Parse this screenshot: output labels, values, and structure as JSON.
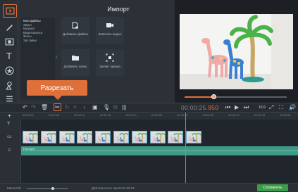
{
  "import_panel": {
    "title": "Импорт",
    "categories": [
      "Мои файлы",
      "Звуки",
      "Музыка",
      "Видеозаписи",
      "Фоны",
      "Заставки"
    ],
    "buttons": [
      {
        "label": "Добавить файлы",
        "icon": "add-files-icon"
      },
      {
        "label": "Записать видео",
        "icon": "camcorder-icon"
      },
      {
        "label": "Добавить папку",
        "icon": "folder-icon"
      },
      {
        "label": "Захват экрана",
        "icon": "screen-capture-icon"
      }
    ]
  },
  "tooltip": {
    "label": "Разрезать"
  },
  "timecode": {
    "main": "00:00:",
    "accent": "25.950"
  },
  "ruler_ticks": [
    "00:00:00",
    "00:00:05",
    "00:00:10",
    "00:00:15",
    "00:00:20",
    "00:00:25",
    "00:00:30",
    "00:00:35",
    "00:00:40",
    "00:00:45",
    "00:00:50"
  ],
  "audio_clip": {
    "name": "Fun.mp3"
  },
  "aspect_ratio": "16:9",
  "footer": {
    "scale_label": "Масштаб:",
    "duration_label": "Длительность проекта:",
    "duration_value": "02:13",
    "save_label": "Сохранить"
  },
  "colors": {
    "accent": "#e0703a",
    "save": "#3c9a48",
    "audio": "#3e9a86"
  }
}
